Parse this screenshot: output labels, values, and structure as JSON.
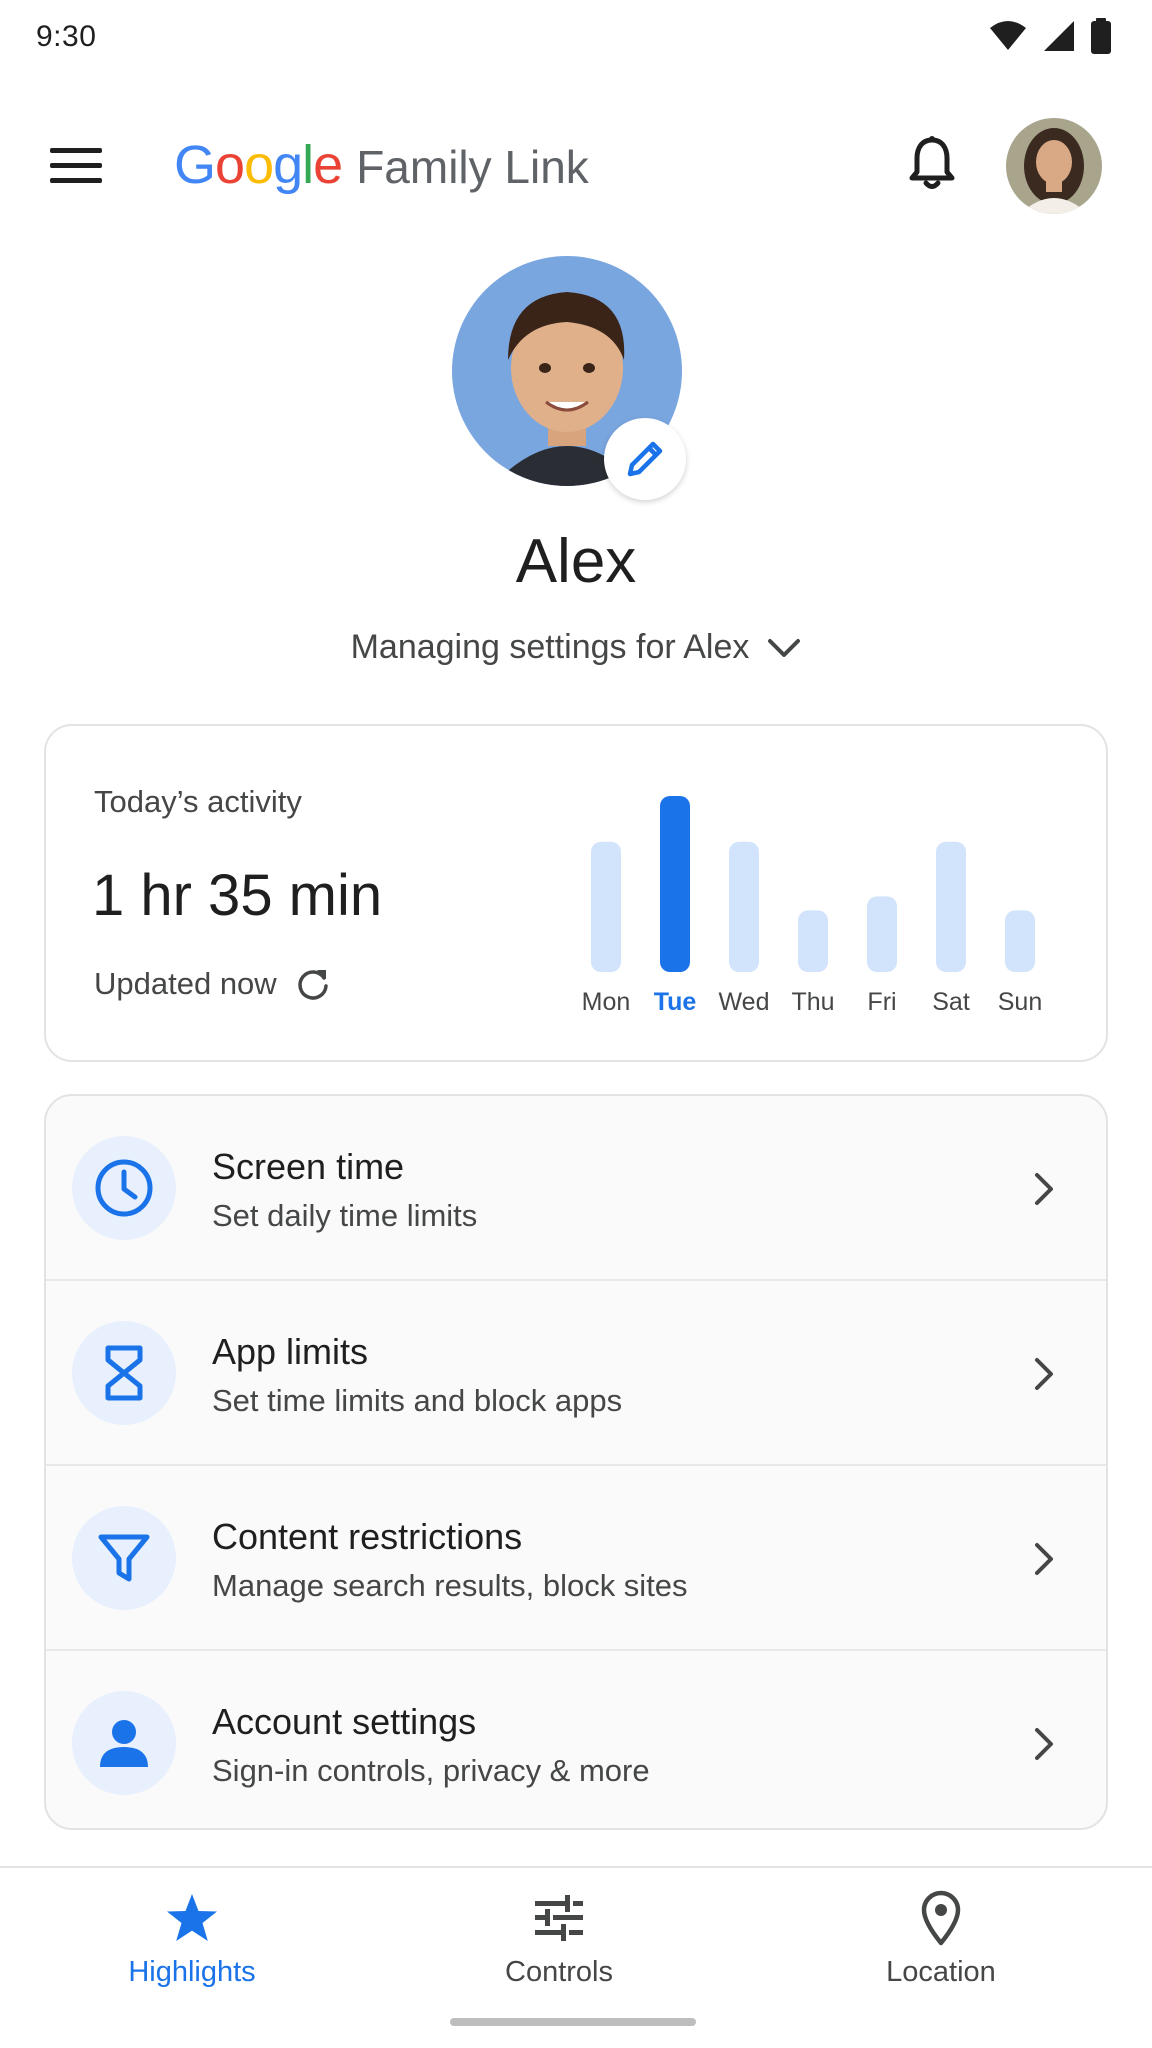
{
  "status_bar": {
    "time": "9:30"
  },
  "app_bar": {
    "logo_letters": [
      {
        "char": "G",
        "color": "#4285F4"
      },
      {
        "char": "o",
        "color": "#EA4335"
      },
      {
        "char": "o",
        "color": "#FBBC05"
      },
      {
        "char": "g",
        "color": "#4285F4"
      },
      {
        "char": "l",
        "color": "#34A853"
      },
      {
        "char": "e",
        "color": "#EA4335"
      }
    ],
    "product_name": "Family Link",
    "menu_icon": "hamburger-menu-icon",
    "notifications_icon": "bell-icon"
  },
  "profile": {
    "name": "Alex",
    "managing_text": "Managing settings for Alex",
    "edit_icon": "pencil-icon"
  },
  "activity": {
    "label": "Today’s activity",
    "total": "1 hr 35 min",
    "updated": "Updated now",
    "refresh_icon": "refresh-icon"
  },
  "chart_data": {
    "type": "bar",
    "categories": [
      "Mon",
      "Tue",
      "Wed",
      "Thu",
      "Fri",
      "Sat",
      "Sun"
    ],
    "values": [
      0.74,
      1.0,
      0.74,
      0.35,
      0.43,
      0.74,
      0.35
    ],
    "highlighted": "Tue",
    "colors": {
      "highlight": "#1a73e8",
      "default": "#d2e3fc"
    }
  },
  "settings": [
    {
      "title": "Screen time",
      "subtitle": "Set daily time limits",
      "icon": "clock-icon"
    },
    {
      "title": "App limits",
      "subtitle": "Set time limits and block apps",
      "icon": "hourglass-icon"
    },
    {
      "title": "Content restrictions",
      "subtitle": "Manage search results, block sites",
      "icon": "filter-icon"
    },
    {
      "title": "Account settings",
      "subtitle": "Sign-in controls, privacy & more",
      "icon": "person-icon"
    }
  ],
  "bottom_nav": [
    {
      "label": "Highlights",
      "icon": "star-icon",
      "active": true
    },
    {
      "label": "Controls",
      "icon": "sliders-icon",
      "active": false
    },
    {
      "label": "Location",
      "icon": "location-pin-icon",
      "active": false
    }
  ],
  "colors": {
    "accent": "#1a73e8",
    "accent_light": "#e8f0fe"
  }
}
